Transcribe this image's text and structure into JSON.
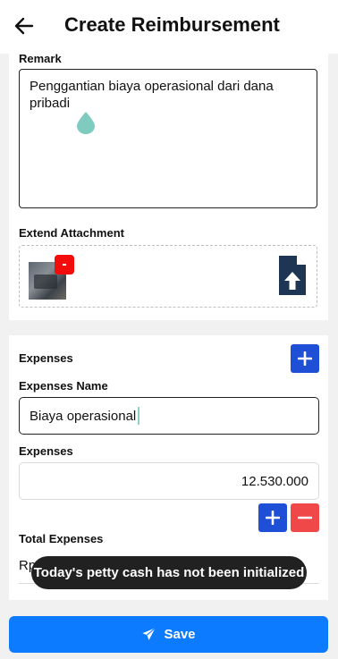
{
  "header": {
    "title": "Create Reimbursement",
    "back_icon": "arrow-left-icon"
  },
  "remark": {
    "label": "Remark",
    "value": "Penggantian biaya operasional dari dana pribadi"
  },
  "attachment": {
    "label": "Extend Attachment",
    "remove_label": "-",
    "upload_icon": "file-upload-icon"
  },
  "expenses_section": {
    "title": "Expenses",
    "name_label": "Expenses Name",
    "name_value": "Biaya operasional",
    "amount_label": "Expenses",
    "amount_value": "12.530.000",
    "total_label": "Total Expenses",
    "total_value": "Rp"
  },
  "toast": {
    "message": "Today's petty cash has not been initialized"
  },
  "footer": {
    "save_label": "Save",
    "save_icon": "paper-plane-icon"
  },
  "colors": {
    "primary": "#0d7bff",
    "add": "#1f4fd6",
    "remove": "#f04848",
    "badge": "#f20c0c",
    "upload": "#1e3553"
  }
}
